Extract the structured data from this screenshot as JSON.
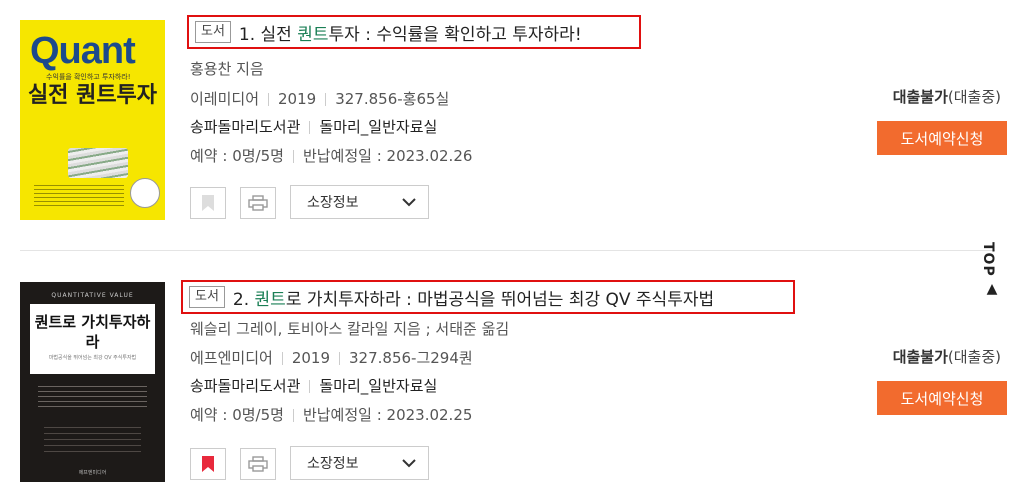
{
  "results": [
    {
      "cover": {
        "big": "Quant",
        "sub": "수익률을 확인하고 투자하라!",
        "title": "실전 퀀트투자"
      },
      "type": "도서",
      "title_prefix": "1. 실전 ",
      "title_highlight": "퀀트",
      "title_suffix": "투자 : 수익률을 확인하고 투자하라!",
      "author": "홍용찬 지음",
      "publisher": "이레미디어",
      "year": "2019",
      "call_no": "327.856-홍65실",
      "library": "송파돌마리도서관",
      "room": "돌마리_일반자료실",
      "reservation": "예약 : 0명/5명",
      "due": "반납예정일 : 2023.02.26",
      "holdings_label": "소장정보",
      "status": "대출불가",
      "status_detail": "(대출중)",
      "reserve_label": "도서예약신청",
      "bookmarked": false
    },
    {
      "cover": {
        "top": "QUANTITATIVE VALUE",
        "title": "퀀트로 가치투자하라",
        "sub": "마법공식을 뛰어넘는 최강 QV 주식투자법",
        "foot": "에프엔미디어"
      },
      "type": "도서",
      "title_prefix": "2. ",
      "title_highlight": "퀀트",
      "title_suffix": "로 가치투자하라 : 마법공식을 뛰어넘는 최강 QV 주식투자법",
      "author": "웨슬리 그레이, 토비아스 칼라일 지음 ; 서태준 옮김",
      "publisher": "에프엔미디어",
      "year": "2019",
      "call_no": "327.856-그294퀀",
      "library": "송파돌마리도서관",
      "room": "돌마리_일반자료실",
      "reservation": "예약 : 0명/5명",
      "due": "반납예정일 : 2023.02.25",
      "holdings_label": "소장정보",
      "status": "대출불가",
      "status_detail": "(대출중)",
      "reserve_label": "도서예약신청",
      "bookmarked": true
    }
  ],
  "top_button": {
    "label": "TOP",
    "arrow": "▲"
  },
  "colors": {
    "highlight": "#1a7f55",
    "reserve": "#f26b2e",
    "bookmark_active": "#e8293c",
    "title_border": "#e01010"
  }
}
